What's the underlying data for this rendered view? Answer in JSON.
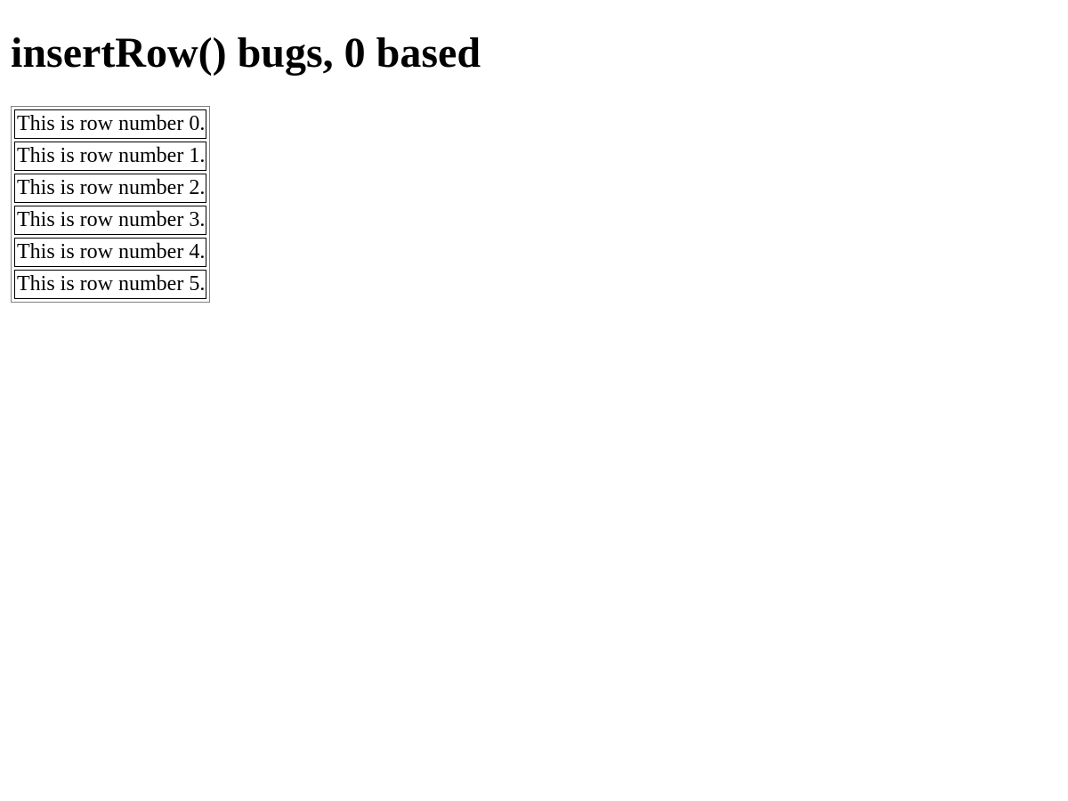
{
  "heading": "insertRow() bugs, 0 based",
  "rows": [
    "This is row number 0.",
    "This is row number 1.",
    "This is row number 2.",
    "This is row number 3.",
    "This is row number 4.",
    "This is row number 5."
  ]
}
